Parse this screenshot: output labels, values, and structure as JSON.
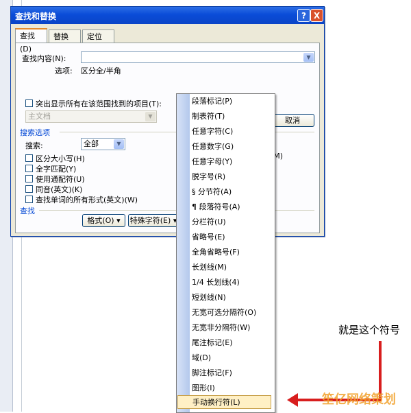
{
  "dialog": {
    "title": "查找和替换",
    "help_btn": "?",
    "close_btn": "X",
    "tabs": [
      {
        "label": "查找(D)",
        "active": true
      },
      {
        "label": "替换(P)",
        "active": false
      },
      {
        "label": "定位(G)",
        "active": false
      }
    ],
    "find_label": "查找内容(N):",
    "options_label": "选项:",
    "options_value": "区分全/半角",
    "highlight_label": "突出显示所有在该范围找到的项目(T):",
    "highlight_scope": "主文档",
    "cancel_label": "取消",
    "search_options_title": "搜索选项",
    "search_label": "搜索:",
    "search_value": "全部",
    "checkboxes": [
      "区分大小写(H)",
      "全字匹配(Y)",
      "使用通配符(U)",
      "同音(英文)(K)",
      "查找单词的所有形式(英文)(W)"
    ],
    "right_hint": "(M)",
    "find_section": "查找",
    "format_btn": "格式(O) ▾",
    "special_btn": "特殊字符(E) ▾"
  },
  "menu": {
    "items": [
      "段落标记(P)",
      "制表符(T)",
      "任意字符(C)",
      "任意数字(G)",
      "任意字母(Y)",
      "脱字号(R)",
      "§ 分节符(A)",
      "¶ 段落符号(A)",
      "分栏符(U)",
      "省略号(E)",
      "全角省略号(F)",
      "长划线(M)",
      "1/4 长划线(4)",
      "短划线(N)",
      "无宽可选分隔符(O)",
      "无宽非分隔符(W)",
      "尾注标记(E)",
      "域(D)",
      "脚注标记(F)",
      "图形(I)",
      "手动换行符(L)"
    ],
    "selected_index": 20
  },
  "annotation": {
    "text": "就是这个符号",
    "color": "#d81e1e"
  },
  "watermark": "笙亿网络策划"
}
